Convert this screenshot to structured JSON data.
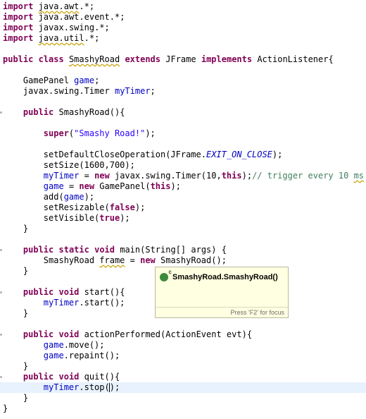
{
  "code": {
    "l1": {
      "kw": "import",
      "pkg": "java.awt",
      "rest": ".*;"
    },
    "l2": {
      "kw": "import",
      "rest": "java.awt.event.*;"
    },
    "l3": {
      "kw": "import",
      "rest": "javax.swing.*;"
    },
    "l4": {
      "kw": "import",
      "pkg": "java.util",
      "rest": ".*;"
    },
    "cls": {
      "kw1": "public",
      "kw2": "class",
      "name": "SmashyRoad",
      "kw3": "extends",
      "sup": "JFrame",
      "kw4": "implements",
      "iface": "ActionListener{"
    },
    "f1": {
      "type": "GamePanel",
      "name": "game",
      "semi": ";"
    },
    "f2": {
      "type": "javax.swing.Timer",
      "name": "myTimer",
      "semi": ";"
    },
    "ctor": {
      "kw": "public",
      "sig": "SmashyRoad(){"
    },
    "sup": {
      "kw": "super",
      "open": "(",
      "str": "\"Smashy Road!\"",
      "close": ");"
    },
    "dco": {
      "pre": "setDefaultCloseOperation(JFrame.",
      "const": "EXIT_ON_CLOSE",
      "post": ");"
    },
    "size": "setSize(1600,700);",
    "timer": {
      "fld": "myTimer",
      "eq": " = ",
      "kw1": "new",
      "mid": " javax.swing.Timer(10,",
      "kw2": "this",
      "end": ");",
      "cmt1": "// trigger every 10 ",
      "cmt2": "ms"
    },
    "gameinit": {
      "fld": "game",
      "eq": " = ",
      "kw1": "new",
      "mid": " GamePanel(",
      "kw2": "this",
      "end": ");"
    },
    "add": {
      "pre": "add(",
      "fld": "game",
      "post": ");"
    },
    "resz": {
      "pre": "setResizable(",
      "kw": "false",
      "post": ");"
    },
    "vis": {
      "pre": "setVisible(",
      "kw": "true",
      "post": ");"
    },
    "close_brace": "}",
    "main": {
      "kw1": "public",
      "kw2": "static",
      "kw3": "void",
      "sig": "main(String[] args) {"
    },
    "frame": {
      "pre": "SmashyRoad ",
      "var": "frame",
      "eq": " = ",
      "kw": "new",
      "post": " SmashyRoad();"
    },
    "start": {
      "kw1": "public",
      "kw2": "void",
      "sig": "start(){"
    },
    "startbody": {
      "fld": "myTimer",
      "post": ".start();"
    },
    "action": {
      "kw1": "public",
      "kw2": "void",
      "sig": "actionPerformed(ActionEvent evt){"
    },
    "move": {
      "fld": "game",
      "post": ".move();"
    },
    "repaint": {
      "fld": "game",
      "post": ".repaint();"
    },
    "quit": {
      "kw1": "public",
      "kw2": "void",
      "sig": "quit(){"
    },
    "stop": {
      "fld": "myTimer",
      "pre": ".stop(",
      "post": ");"
    }
  },
  "hover": {
    "icon": "constructor-icon",
    "icon_badge": "c",
    "title": "SmashyRoad.SmashyRoad()",
    "footer": "Press 'F2' for focus"
  }
}
